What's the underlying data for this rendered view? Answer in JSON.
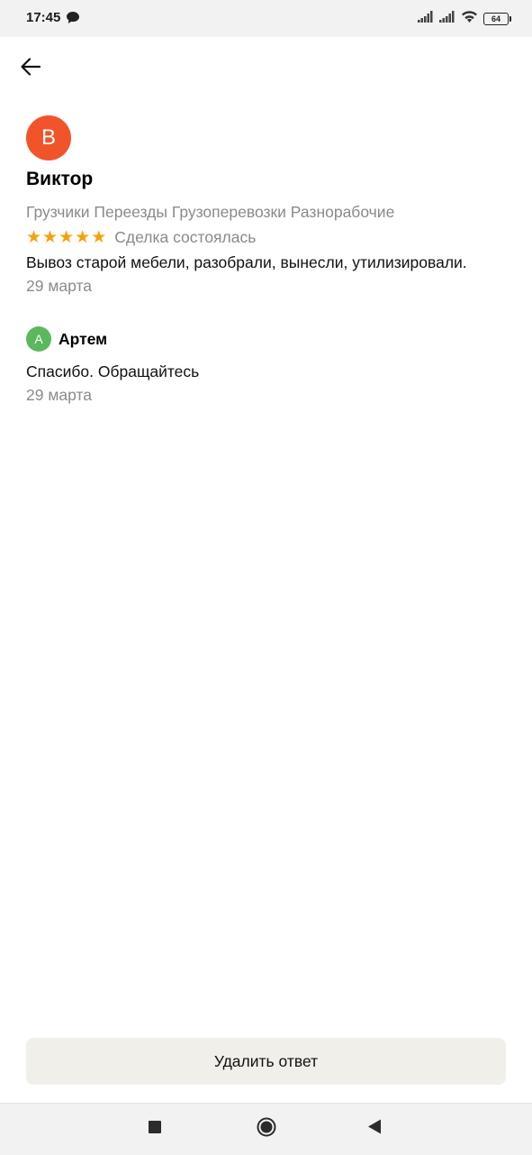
{
  "status_bar": {
    "time": "17:45",
    "battery": "64",
    "icons": [
      "message-icon",
      "signal-icon",
      "signal-icon",
      "wifi-icon",
      "battery-icon"
    ]
  },
  "header": {
    "back_icon": "arrow-left-icon"
  },
  "review": {
    "avatar_letter": "В",
    "avatar_color": "#f1542a",
    "author": "Виктор",
    "tags": "Грузчики Переезды Грузоперевозки Разнорабочие",
    "rating": 5,
    "rating_max": 5,
    "star_color": "#f5a00f",
    "deal_status": "Сделка состоялась",
    "text": "Вывоз старой мебели, разобрали, вынесли, утилизировали.",
    "date": "29 марта"
  },
  "reply": {
    "avatar_letter": "А",
    "avatar_color": "#5cb85c",
    "author": "Артем",
    "text": "Спасибо. Обращайтесь",
    "date": "29 марта"
  },
  "actions": {
    "delete_label": "Удалить ответ"
  },
  "nav_bar": {
    "icons": [
      "recent-apps-icon",
      "home-icon",
      "back-icon"
    ]
  }
}
